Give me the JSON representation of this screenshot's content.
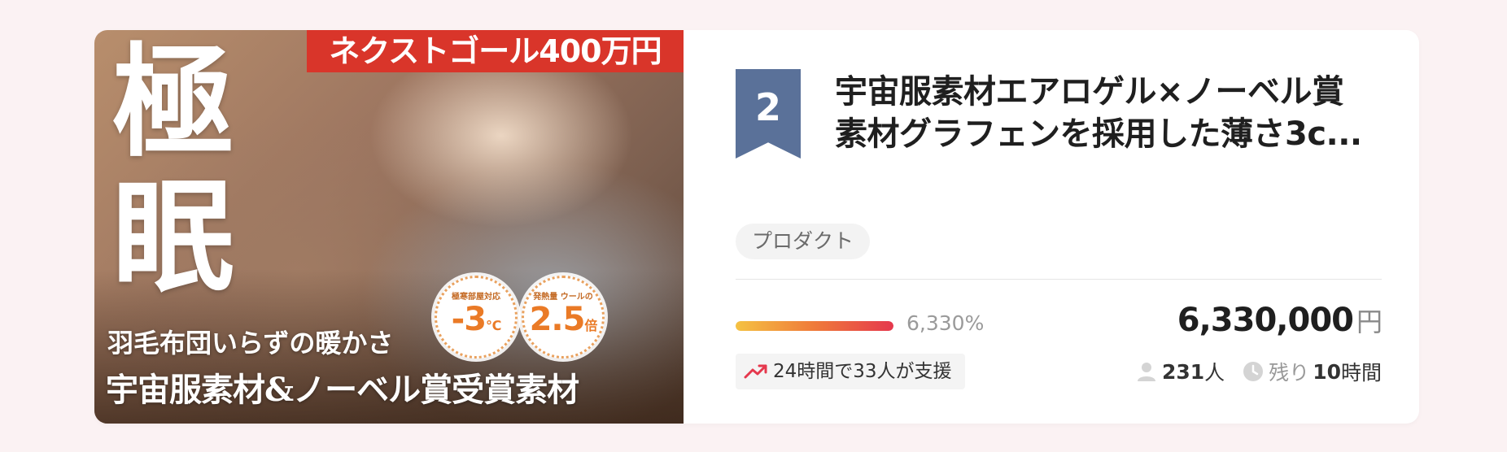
{
  "thumbnail": {
    "goal_banner": "ネクストゴール400万円",
    "kanji_1": "極",
    "kanji_2": "眠",
    "tagline": "羽毛布団いらずの暖かさ",
    "headline": "宇宙服素材&ノーベル賞受賞素材",
    "badge_1": {
      "caption": "極寒部屋対応",
      "value": "-3",
      "unit": "℃"
    },
    "badge_2": {
      "caption": "発熱量 ウールの",
      "value": "2.5",
      "unit": "倍"
    }
  },
  "project": {
    "rank": "2",
    "title_line_1": "宇宙服素材エアロゲル×ノーベル賞",
    "title_line_2": "素材グラフェンを採用した薄さ3c...",
    "category": "プロダクト",
    "progress": {
      "percent_text": "6,330%",
      "fill_fraction": 1.0
    },
    "amount": "6,330,000",
    "currency": "円",
    "trend_text": "24時間で33人が支援",
    "supporters": "231",
    "supporters_unit": "人",
    "remaining_label": "残り",
    "remaining_value": "10",
    "remaining_unit": "時間"
  },
  "colors": {
    "rank_badge": "#5a7199",
    "trend_arrow": "#e5384d",
    "goal_banner": "#d9352a"
  },
  "icons": [
    "trend-up-icon",
    "person-icon",
    "clock-icon"
  ]
}
